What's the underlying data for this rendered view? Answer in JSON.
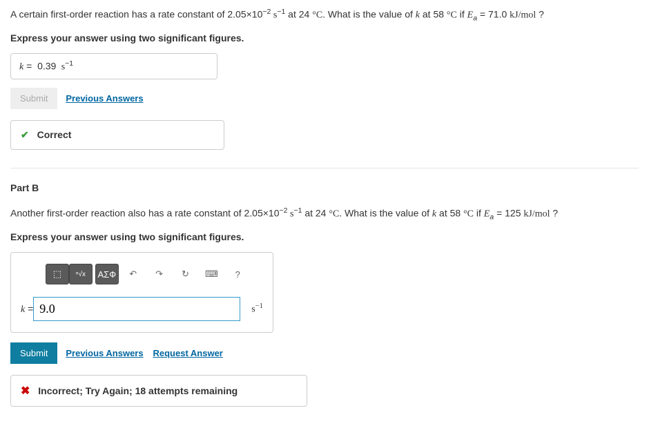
{
  "partA": {
    "question_prefix": "A certain first-order reaction has a rate constant of 2.05×10",
    "q_exp1": "−2",
    "q_unit1": " s",
    "q_exp2": "−1",
    "q_mid": " at 24 ",
    "q_deg": "°C",
    "q_tail1": ". What is the value of ",
    "q_var_k": "k",
    "q_tail2": " at 58 ",
    "q_deg2": "°C",
    "q_tail3": " if ",
    "q_var_Ea": "E",
    "q_sub_a": "a",
    "q_tail4": " = 71.0 ",
    "q_unit_kj": "kJ/mol",
    "q_tail5": " ?",
    "instruction": "Express your answer using two significant figures.",
    "answer_prefix": "k",
    "answer_eq": " = ",
    "answer_value": "0.39",
    "answer_unit_s": " s",
    "answer_unit_exp": "−1",
    "submit": "Submit",
    "prev": "Previous Answers",
    "feedback": "Correct"
  },
  "partB": {
    "title": "Part B",
    "question_prefix": "Another first-order reaction also has a rate constant of 2.05×10",
    "q_exp1": "−2",
    "q_unit1": " s",
    "q_exp2": "−1",
    "q_mid": " at 24 ",
    "q_deg": "°C",
    "q_tail1": ". What is the value of ",
    "q_var_k": "k",
    "q_tail2": " at 58 ",
    "q_deg2": "°C",
    "q_tail3": " if ",
    "q_var_Ea": "E",
    "q_sub_a": "a",
    "q_tail4": " = 125 ",
    "q_unit_kj": "kJ/mol",
    "q_tail5": " ?",
    "instruction": "Express your answer using two significant figures.",
    "toolbar": {
      "templates": "⬚",
      "root": "ⁿ√x",
      "greek": "ΑΣФ",
      "undo": "↶",
      "redo": "↷",
      "reset": "↻",
      "keyboard": "⌨",
      "help": "?"
    },
    "answer_prefix": "k",
    "answer_eq": " = ",
    "answer_value": "9.0",
    "answer_unit_s": "s",
    "answer_unit_exp": "−1",
    "submit": "Submit",
    "prev": "Previous Answers",
    "request": "Request Answer",
    "feedback": "Incorrect; Try Again; 18 attempts remaining"
  }
}
